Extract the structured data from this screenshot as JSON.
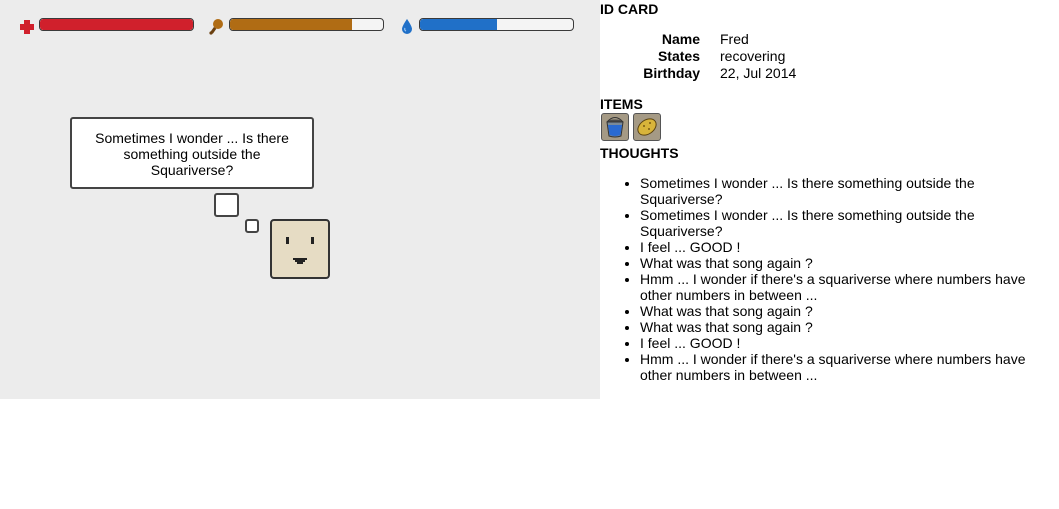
{
  "stats": {
    "health": {
      "icon": "red-cross-icon",
      "color": "#d0202c",
      "level": 1.0
    },
    "food": {
      "icon": "drumstick-icon",
      "color": "#b06c14",
      "level": 0.8
    },
    "water": {
      "icon": "water-drop-icon",
      "color": "#2070c8",
      "level": 0.5
    }
  },
  "thought_bubble": {
    "text": "Sometimes I wonder ... Is there something outside the Squariverse?"
  },
  "character": {
    "name": "square-character",
    "color": "#e6dcc4"
  },
  "id_card": {
    "title": "ID CARD",
    "name_label": "Name",
    "name_value": "Fred",
    "states_label": "States",
    "states_value": "recovering",
    "birthday_label": "Birthday",
    "birthday_value": "22, Jul 2014"
  },
  "items": {
    "title": "ITEMS",
    "list": [
      {
        "icon": "water-bucket-icon"
      },
      {
        "icon": "potato-icon"
      }
    ]
  },
  "thoughts": {
    "title": "THOUGHTS",
    "list": [
      "Sometimes I wonder ... Is there something outside the Squariverse?",
      "Sometimes I wonder ... Is there something outside the Squariverse?",
      "I feel ... GOOD !",
      "What was that song again ?",
      "Hmm ... I wonder if there's a squariverse where numbers have other numbers in between ...",
      "What was that song again ?",
      "What was that song again ?",
      "I feel ... GOOD !",
      "Hmm ... I wonder if there's a squariverse where numbers have other numbers in between ..."
    ]
  }
}
